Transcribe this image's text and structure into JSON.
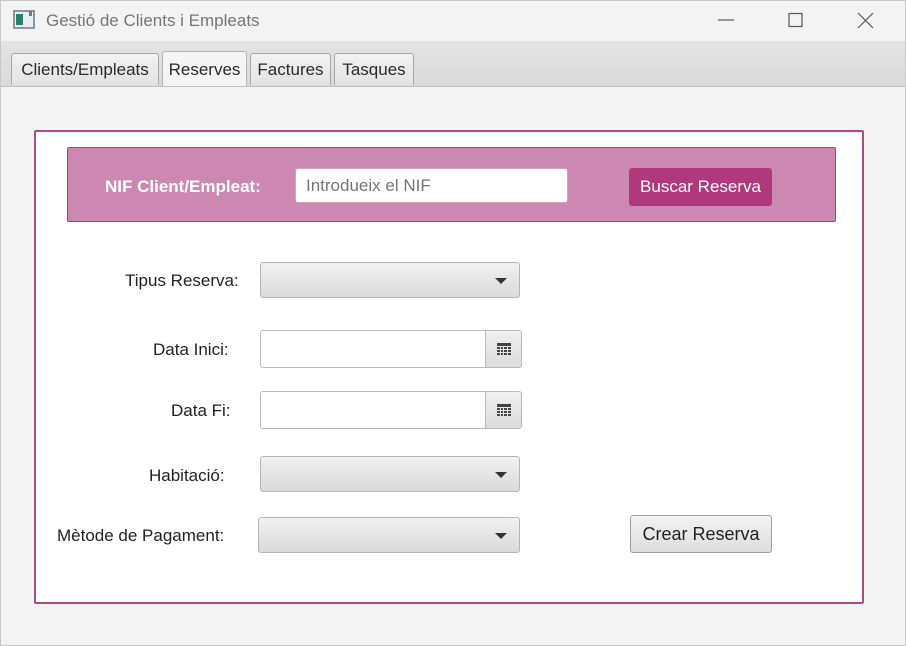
{
  "window": {
    "title": "Gestió de Clients i Empleats"
  },
  "tabs": [
    {
      "label": "Clients/Empleats"
    },
    {
      "label": "Reserves"
    },
    {
      "label": "Factures"
    },
    {
      "label": "Tasques"
    }
  ],
  "active_tab": "Reserves",
  "search": {
    "label": "NIF Client/Empleat:",
    "placeholder": "Introdueix el NIF",
    "value": "",
    "button_label": "Buscar Reserva"
  },
  "form": {
    "tipus_reserva": {
      "label": "Tipus Reserva:",
      "value": ""
    },
    "data_inici": {
      "label": "Data Inici:",
      "value": ""
    },
    "data_fi": {
      "label": "Data Fi:",
      "value": ""
    },
    "habitacio": {
      "label": "Habitació:",
      "value": ""
    },
    "metode_pagament": {
      "label": "Mètode de Pagament:",
      "value": ""
    },
    "create_button_label": "Crear Reserva"
  },
  "colors": {
    "accent": "#b1397b",
    "panel_border": "#b04985",
    "search_bar_bg": "#cd88b1"
  },
  "icons": [
    "app-icon",
    "minimize-icon",
    "maximize-icon",
    "close-icon",
    "calendar-icon",
    "dropdown-arrow-icon"
  ]
}
